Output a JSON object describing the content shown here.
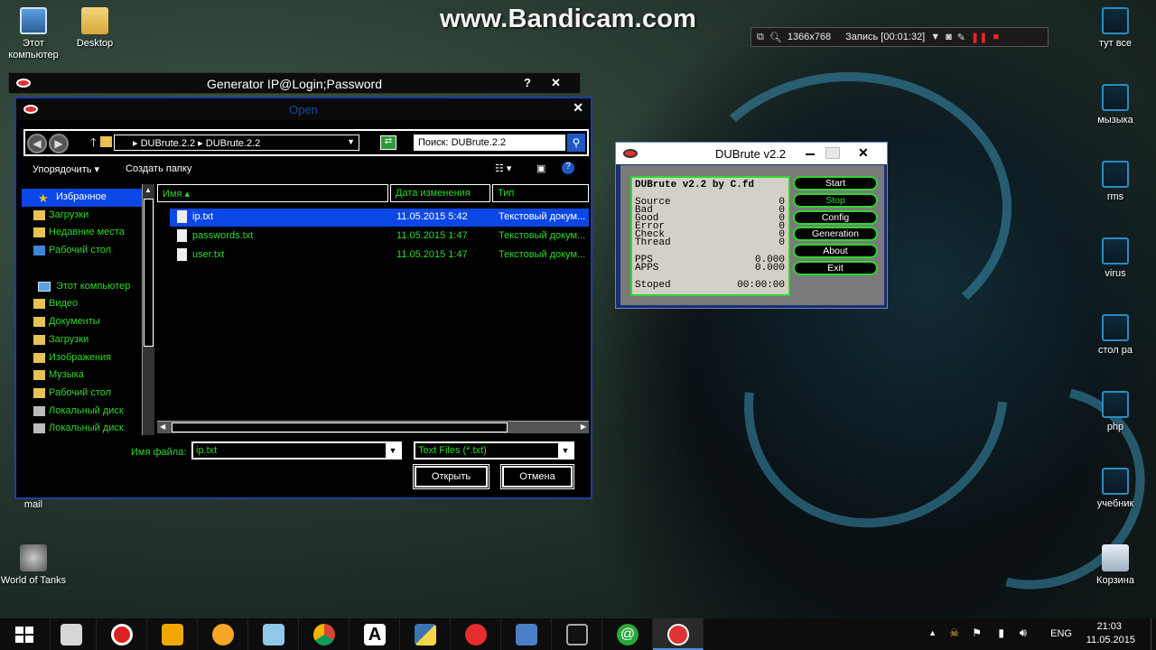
{
  "watermark": "www.Bandicam.com",
  "recorder": {
    "resolution": "1366x768",
    "status": "Запись [00:01:32]"
  },
  "desktop": {
    "left_icons": [
      {
        "label": "Этот компьютер",
        "icon": "computer-icon"
      },
      {
        "label": "Desktop",
        "icon": "folder-icon"
      },
      {
        "label": "mail",
        "icon": "folder-icon"
      },
      {
        "label": "World of Tanks",
        "icon": "world-of-tanks-icon"
      }
    ],
    "right_icons": [
      {
        "label": "тут все",
        "icon": "folder-icon"
      },
      {
        "label": "мызыка",
        "icon": "folder-icon"
      },
      {
        "label": "rms",
        "icon": "folder-icon"
      },
      {
        "label": "virus",
        "icon": "folder-icon"
      },
      {
        "label": "стол ра",
        "icon": "folder-icon"
      },
      {
        "label": "php",
        "icon": "folder-icon"
      },
      {
        "label": "учебник",
        "icon": "folder-icon"
      },
      {
        "label": "Корзина",
        "icon": "recycle-bin-icon"
      }
    ]
  },
  "generator_window": {
    "title": "Generator IP@Login;Password",
    "help": "?",
    "close": "✕"
  },
  "open_dialog": {
    "title": "Open",
    "close": "✕",
    "path": [
      "DUBrute.2.2",
      "DUBrute.2.2"
    ],
    "search_placeholder": "Поиск: DUBrute.2.2",
    "organize": "Упорядочить",
    "new_folder": "Создать папку",
    "favorites": {
      "label": "Избранное",
      "items": [
        "Загрузки",
        "Недавние места",
        "Рабочий стол"
      ]
    },
    "computer": {
      "label": "Этот компьютер",
      "items": [
        "Видео",
        "Документы",
        "Загрузки",
        "Изображения",
        "Музыка",
        "Рабочий стол",
        "Локальный диск",
        "Локальный диск"
      ]
    },
    "columns": [
      "Имя",
      "Дата изменения",
      "Тип"
    ],
    "files": [
      {
        "name": "ip.txt",
        "date": "11.05.2015 5:42",
        "type": "Текстовый докум..."
      },
      {
        "name": "passwords.txt",
        "date": "11.05.2015 1:47",
        "type": "Текстовый докум..."
      },
      {
        "name": "user.txt",
        "date": "11.05.2015 1:47",
        "type": "Текстовый докум..."
      }
    ],
    "filename_label": "Имя файла:",
    "filename_value": "ip.txt",
    "filetype": "Text Files (*.txt)",
    "open_btn": "Открыть",
    "cancel_btn": "Отмена"
  },
  "dubrute": {
    "title": "DUBrute v2.2",
    "header": "DUBrute v2.2 by C.fd",
    "stats": [
      {
        "k": "Source",
        "v": "0"
      },
      {
        "k": "Bad",
        "v": "0"
      },
      {
        "k": "Good",
        "v": "0"
      },
      {
        "k": "Error",
        "v": "0"
      },
      {
        "k": "Check",
        "v": "0"
      },
      {
        "k": "Thread",
        "v": "0"
      }
    ],
    "pps": {
      "k": "PPS",
      "v": "0.000"
    },
    "apps": {
      "k": "APPS",
      "v": "0.000"
    },
    "state": {
      "k": "Stoped",
      "v": "00:00:00"
    },
    "buttons": [
      "Start",
      "Stop",
      "Config",
      "Generation",
      "About",
      "Exit"
    ]
  },
  "taskbar": {
    "lang": "ENG",
    "time": "21:03",
    "date": "11.05.2015"
  }
}
